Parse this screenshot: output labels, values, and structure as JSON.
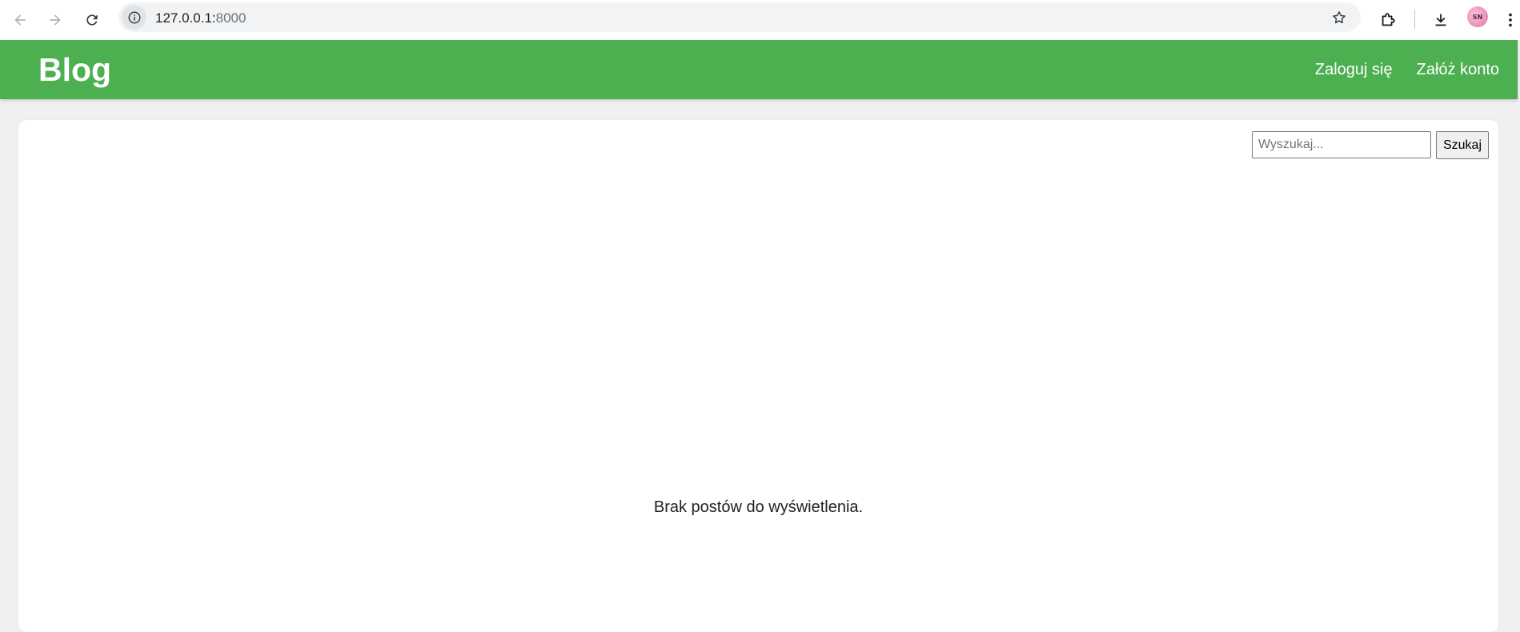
{
  "browser": {
    "url_host": "127.0.0.1:",
    "url_port": "8000",
    "avatar_text": "SN"
  },
  "header": {
    "brand": "Blog",
    "nav": {
      "login_label": "Zaloguj się",
      "register_label": "Załóż konto"
    }
  },
  "search": {
    "placeholder": "Wyszukaj...",
    "value": "",
    "button_label": "Szukaj"
  },
  "main": {
    "empty_message": "Brak postów do wyświetlenia."
  },
  "colors": {
    "header_bg": "#4caf50",
    "page_bg": "#f0f0f0",
    "card_bg": "#ffffff"
  }
}
